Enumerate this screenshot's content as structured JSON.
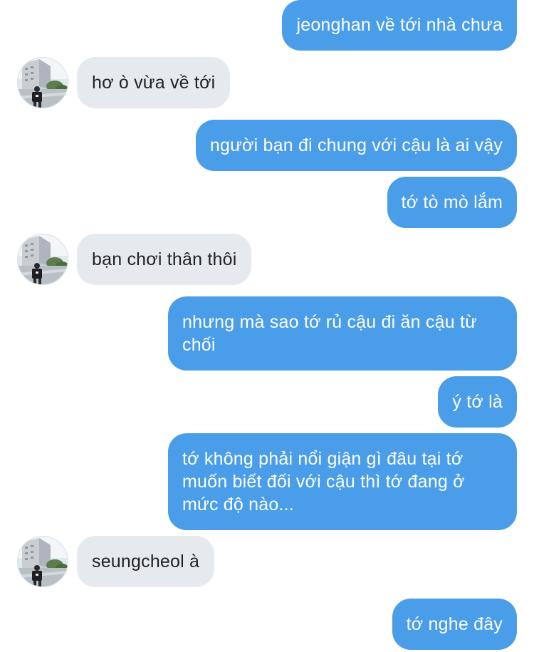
{
  "conversation": {
    "messages": [
      {
        "direction": "outgoing",
        "text": "jeonghan về tới nhà chưa"
      },
      {
        "direction": "incoming",
        "text": "hơ ò vừa về tới",
        "avatar_icon": "contact-avatar-photo-icon"
      },
      {
        "direction": "outgoing",
        "text": "người bạn đi chung với cậu là ai vậy"
      },
      {
        "direction": "outgoing",
        "text": "tớ tò mò lắm"
      },
      {
        "direction": "incoming",
        "text": "bạn chơi thân thôi",
        "avatar_icon": "contact-avatar-photo-icon"
      },
      {
        "direction": "outgoing",
        "text": "nhưng mà sao tớ rủ cậu đi ăn cậu từ chối"
      },
      {
        "direction": "outgoing",
        "text": "ý tớ là"
      },
      {
        "direction": "outgoing",
        "text": "tớ không phải nổi giận gì đâu tại tớ muốn biết đối với cậu thì tớ đang ở mức độ nào..."
      },
      {
        "direction": "incoming",
        "text": "seungcheol à",
        "avatar_icon": "contact-avatar-photo-icon"
      },
      {
        "direction": "outgoing",
        "text": "tớ nghe đây"
      }
    ]
  },
  "colors": {
    "outgoing_bubble": "#4a9de8",
    "outgoing_text": "#ffffff",
    "incoming_bubble": "#e6e9ee",
    "incoming_text": "#222222",
    "background": "#ffffff"
  }
}
